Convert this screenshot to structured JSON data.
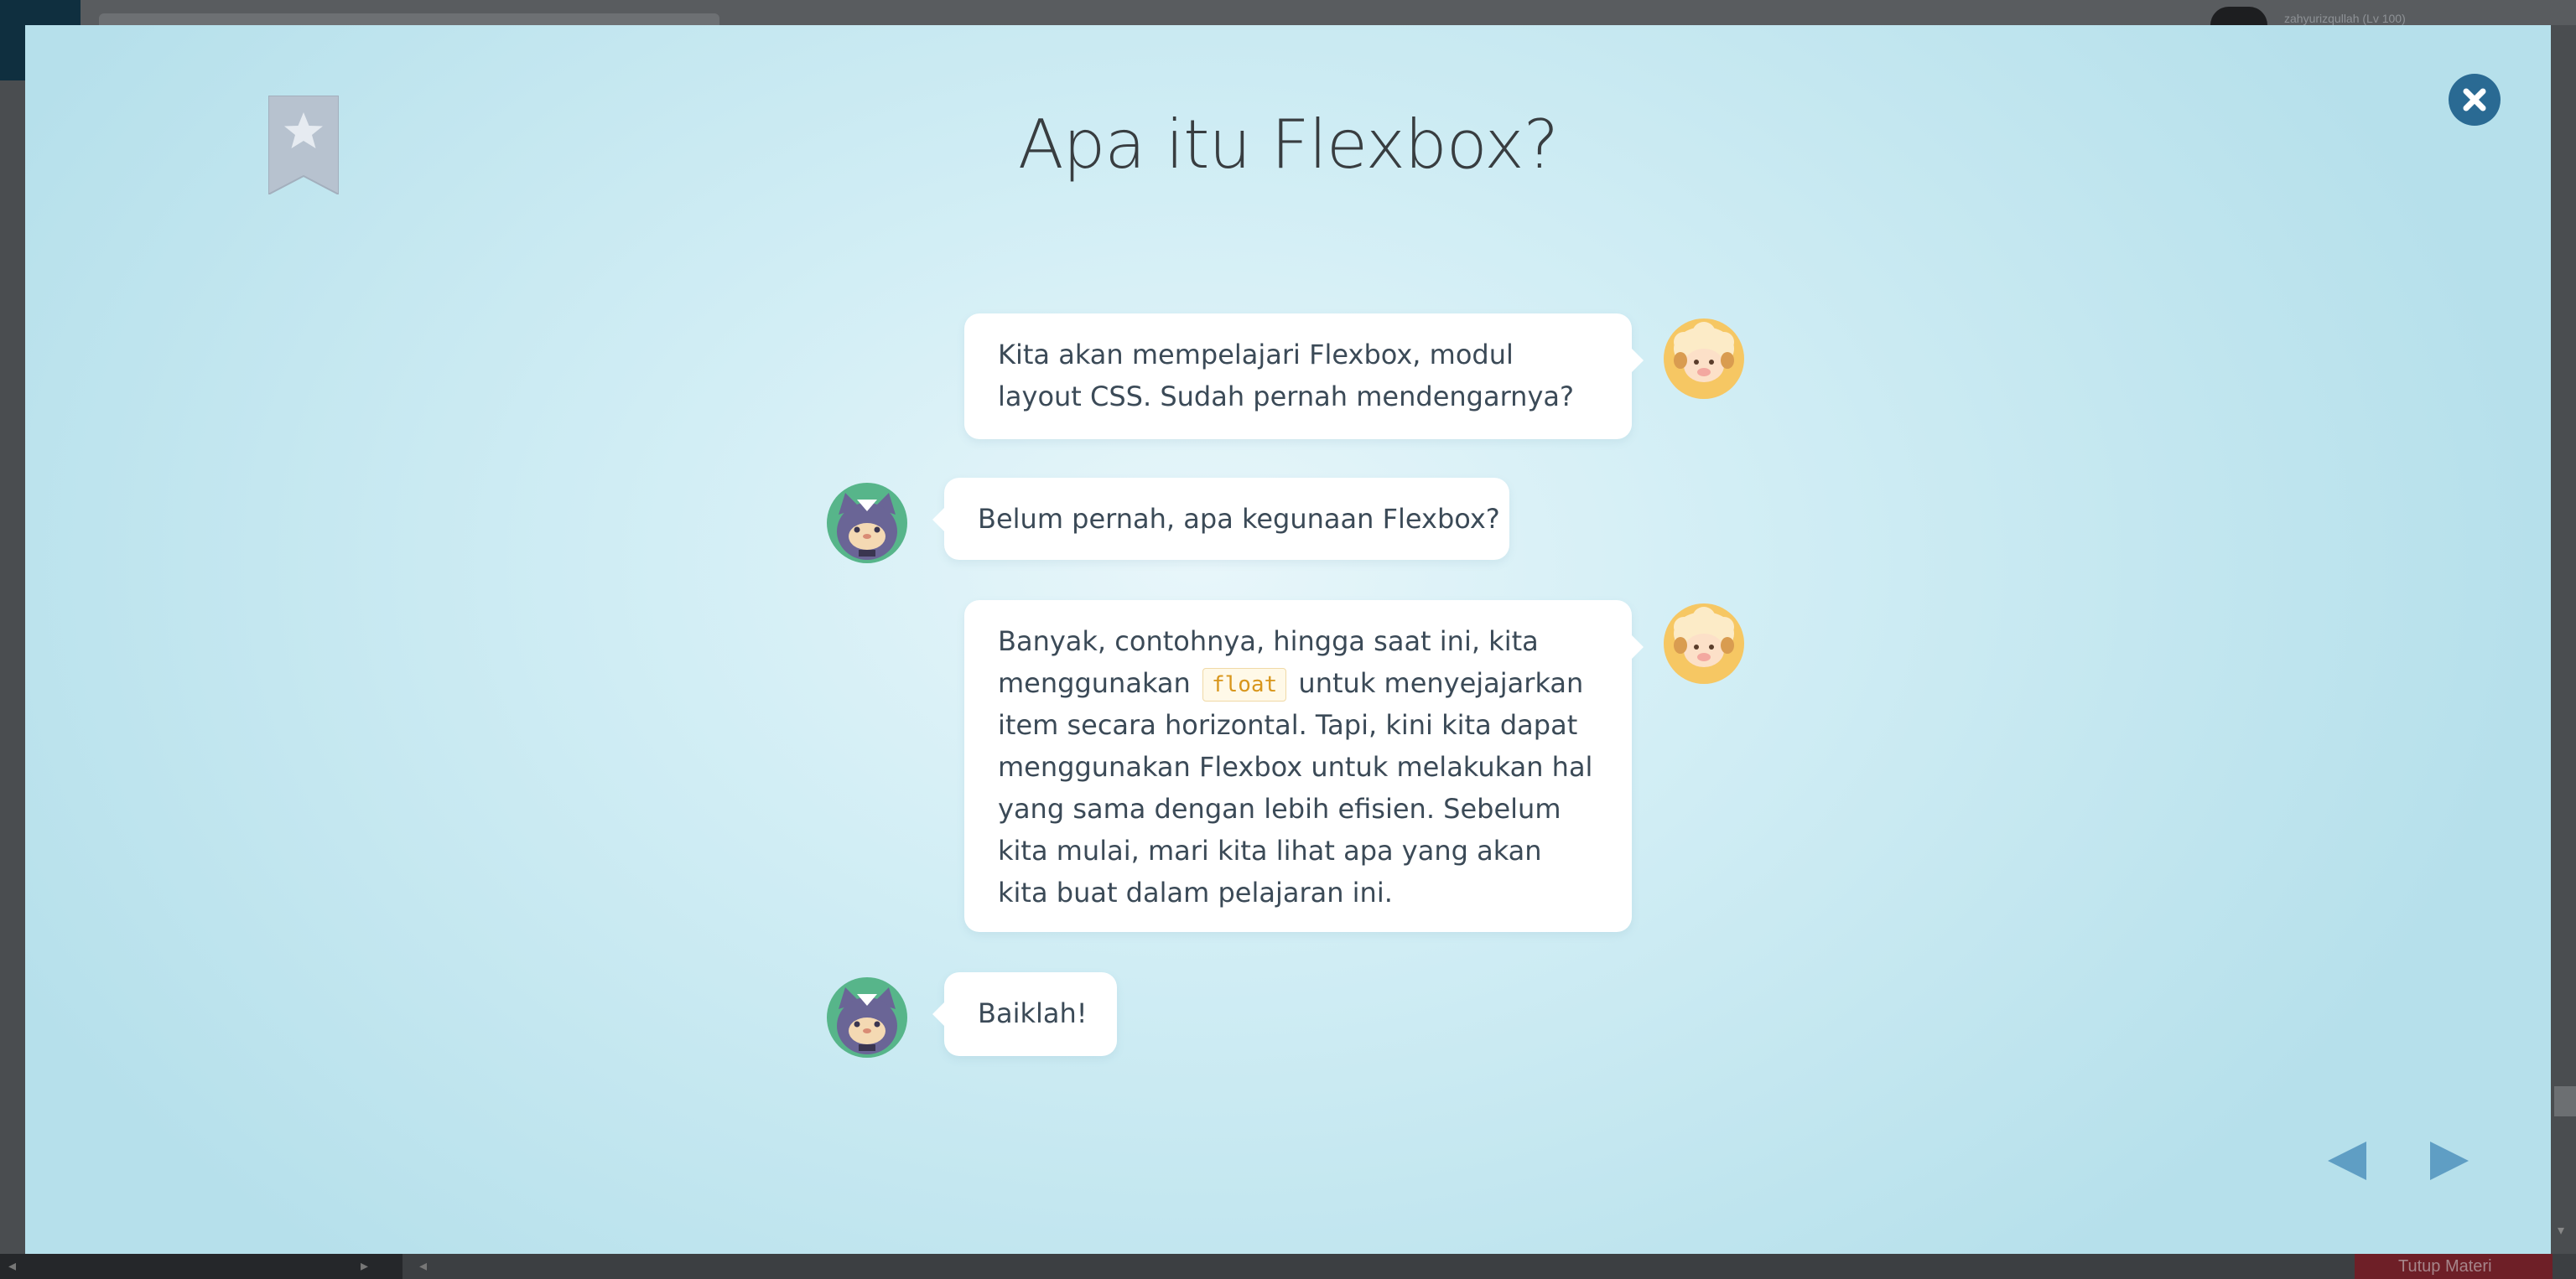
{
  "background_page": {
    "username": "zahyurizqullah (Lv 100)",
    "bottom_button": "Tutup Materi"
  },
  "modal": {
    "title": "Apa itu Flexbox?",
    "bookmark_icon": "bookmark-star-icon",
    "close_icon": "close-icon",
    "messages": [
      {
        "speaker": "sheep",
        "side": "right",
        "text": "Kita akan mempelajari Flexbox, modul layout CSS. Sudah pernah mendengarnya?"
      },
      {
        "speaker": "cat",
        "side": "left",
        "text": "Belum pernah, apa kegunaan Flexbox?"
      },
      {
        "speaker": "sheep",
        "side": "right",
        "text_before": "Banyak, contohnya, hingga saat ini, kita menggunakan",
        "code": "float",
        "text_after": "untuk menyejajarkan item secara horizontal. Tapi, kini kita dapat menggunakan Flexbox untuk melakukan hal yang sama dengan lebih efisien. Sebelum kita mulai, mari kita lihat apa yang akan kita buat dalam pelajaran ini."
      },
      {
        "speaker": "cat",
        "side": "left",
        "text": "Baiklah!"
      }
    ],
    "navigation": {
      "prev_icon": "triangle-left-icon",
      "next_icon": "triangle-right-icon"
    }
  },
  "colors": {
    "accent": "#2a6a93",
    "nav_arrow": "#5f9ec4",
    "code_text": "#d8961c",
    "text": "#3b4a57"
  }
}
